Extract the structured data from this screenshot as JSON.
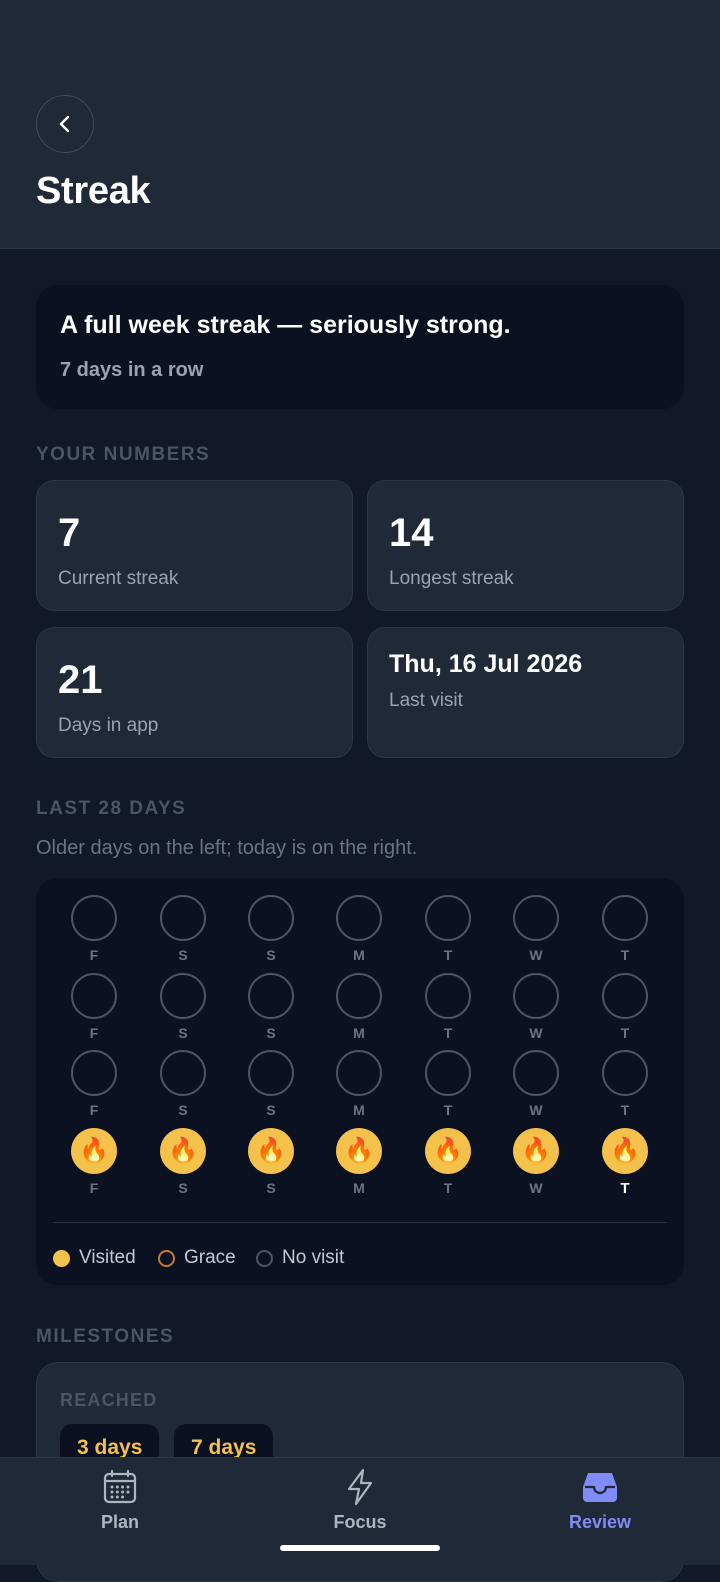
{
  "header": {
    "title": "Streak"
  },
  "hero": {
    "title": "A full week streak — seriously strong.",
    "subtitle": "7 days in a row"
  },
  "numbers": {
    "label": "YOUR NUMBERS",
    "current_streak": {
      "value": "7",
      "label": "Current streak"
    },
    "longest_streak": {
      "value": "14",
      "label": "Longest streak"
    },
    "days_in_app": {
      "value": "21",
      "label": "Days in app"
    },
    "last_visit": {
      "value": "Thu, 16 Jul 2026",
      "label": "Last visit"
    }
  },
  "last28": {
    "label": "LAST 28 DAYS",
    "hint": "Older days on the left; today is on the right.",
    "weekday_labels": [
      "F",
      "S",
      "S",
      "M",
      "T",
      "W",
      "T"
    ],
    "rows": [
      [
        "none",
        "none",
        "none",
        "none",
        "none",
        "none",
        "none"
      ],
      [
        "none",
        "none",
        "none",
        "none",
        "none",
        "none",
        "none"
      ],
      [
        "none",
        "none",
        "none",
        "none",
        "none",
        "none",
        "none"
      ],
      [
        "visited",
        "visited",
        "visited",
        "visited",
        "visited",
        "visited",
        "visited"
      ]
    ],
    "legend": {
      "visited": "Visited",
      "grace": "Grace",
      "none": "No visit"
    },
    "colors": {
      "visited": "#f4c14a",
      "grace": "#c47a35",
      "none": "#4b5566"
    }
  },
  "milestones": {
    "label": "MILESTONES",
    "reached_label": "REACHED",
    "reached": [
      "3 days",
      "7 days"
    ]
  },
  "nav": {
    "items": [
      {
        "label": "Plan",
        "icon": "calendar-icon",
        "active": false
      },
      {
        "label": "Focus",
        "icon": "lightning-icon",
        "active": false
      },
      {
        "label": "Review",
        "icon": "inbox-icon",
        "active": true
      }
    ],
    "accent": "#818cf8"
  }
}
